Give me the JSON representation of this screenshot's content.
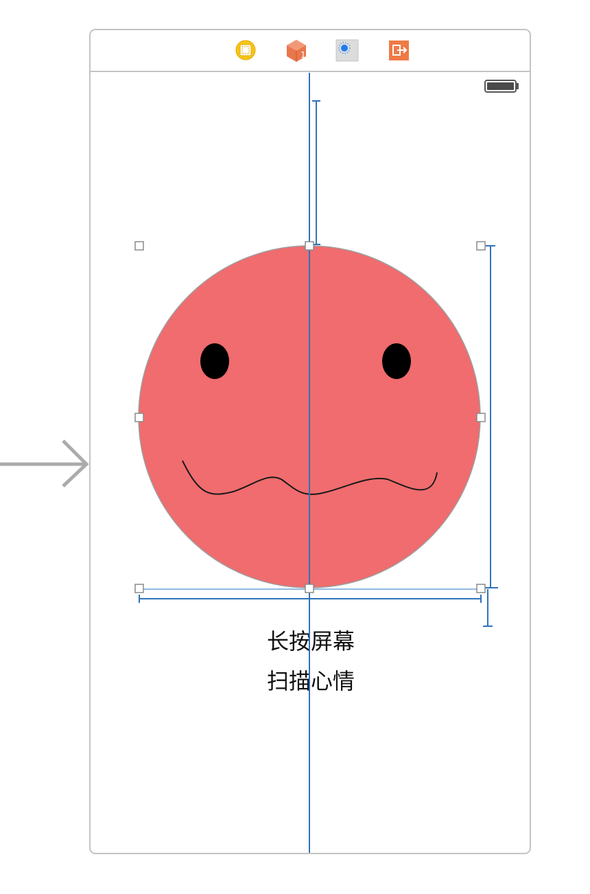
{
  "scene": {
    "toolbar_icons": [
      {
        "name": "view-controller-icon",
        "color": "#F5C518"
      },
      {
        "name": "first-responder-icon",
        "color": "#E9764C",
        "text": "1"
      },
      {
        "name": "dotted-circle-icon",
        "color": "#1E7CF0"
      },
      {
        "name": "exit-icon",
        "color": "#EF7A45"
      }
    ],
    "status_bar": {
      "icon": "battery-icon"
    },
    "face": {
      "fill_color": "#F06C6E",
      "eye_color": "#000000",
      "mouth_color": "#000000"
    },
    "constraint_color": "#2F73B8",
    "entry_arrow": {
      "icon": "initial-view-arrow-icon",
      "color": "#ABABAB"
    },
    "label": {
      "line1": "长按屏幕",
      "line2": "扫描心情"
    }
  }
}
